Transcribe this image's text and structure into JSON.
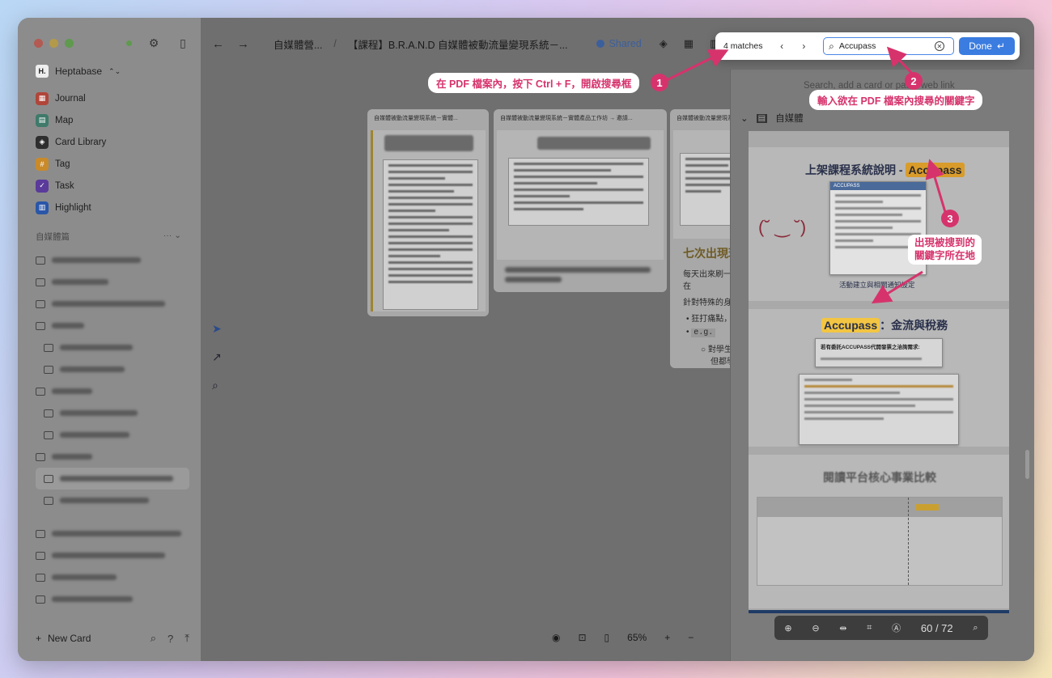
{
  "sidebar": {
    "workspace": "Heptabase",
    "workspace_logo": "H.",
    "nav": [
      {
        "label": "Journal",
        "icon": "journal-icon",
        "color": "#b0453a"
      },
      {
        "label": "Map",
        "icon": "map-icon",
        "color": "#3f7a6a"
      },
      {
        "label": "Card Library",
        "icon": "card-library-icon",
        "color": "#2e2e2e"
      },
      {
        "label": "Tag",
        "icon": "tag-icon",
        "color": "#c98a2a"
      },
      {
        "label": "Task",
        "icon": "task-icon",
        "color": "#5a3a9a"
      },
      {
        "label": "Highlight",
        "icon": "highlight-icon",
        "color": "#2a56a8"
      }
    ],
    "section_title": "自媒體篇",
    "new_card": "New Card"
  },
  "topbar": {
    "crumb_1": "自媒體營...",
    "crumb_sep": "/",
    "crumb_2": "【課程】B.R.A.N.D 自媒體被動流量變現系統－...",
    "shared": "Shared"
  },
  "canvas": {
    "card1_head": "自媒體被動流量變現系統－實體...",
    "card2_head": "自媒體被動流量變現系統－實體產品工作坊 → 邀請...",
    "card3_head": "自媒體被動流量變現系統－實...",
    "card3_title": "七次出現理論",
    "card3_line1": "每天出來刷一次存在",
    "card3_line2": "針對特殊的身份",
    "card3_bullet1": "狂打痛點，回答",
    "card3_bullet2": "e.g.",
    "card3_sub1": "對學生：你",
    "card3_sub2": "但都學不進"
  },
  "zoom": {
    "level": "65%"
  },
  "right_panel": {
    "search_placeholder": "Search, add a card or paste web link",
    "pdf_title": "自媒體",
    "slide1_title_prefix": "上架課程系統說明 - ",
    "slide1_title_hl": "Accupass",
    "slide1_caption": "活動建立與相關通知設定",
    "slide1_mini_bar": "ACCUPASS",
    "slide2_title_hl": "Accupass",
    "slide2_title_suffix": "：金流與稅務",
    "slide2_box_title": "若有委託ACCUPASS代開發票之洽詢需求:",
    "slide3_title": "閱讀平台核心事業比較",
    "page_indicator": "60 / 72"
  },
  "findbar": {
    "matches": "4 matches",
    "query": "Accupass",
    "done": "Done"
  },
  "annotations": {
    "a1": "在 PDF 檔案內，按下 Ctrl + F，開啟搜尋框",
    "a2": "輸入欲在 PDF 檔案內搜尋的關鍵字",
    "a3_line1": "出現被搜到的",
    "a3_line2": "關鍵字所在地",
    "n1": "1",
    "n2": "2",
    "n3": "3"
  },
  "colors": {
    "accent": "#d6336c",
    "highlight": "#f3c542",
    "primary": "#3a7ce0"
  }
}
